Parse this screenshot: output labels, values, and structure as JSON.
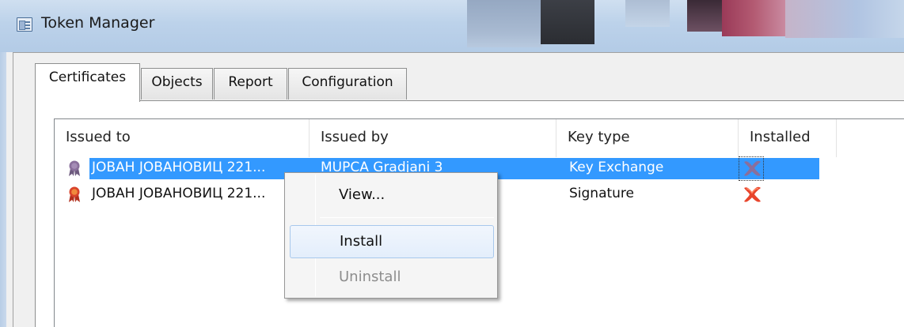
{
  "window": {
    "title": "Token Manager"
  },
  "tabs": [
    {
      "label": "Certificates",
      "active": true
    },
    {
      "label": "Objects",
      "active": false
    },
    {
      "label": "Report",
      "active": false
    },
    {
      "label": "Configuration",
      "active": false
    }
  ],
  "table": {
    "columns": [
      "Issued to",
      "Issued by",
      "Key type",
      "Installed"
    ],
    "rows": [
      {
        "issued_to": "ЈОВАН ЈОВАНОВИЦ 221...",
        "issued_by": "MUPCA Gradjani 3",
        "key_type": "Key Exchange",
        "installed": "no",
        "selected": true,
        "icon": "certificate-ribbon-icon"
      },
      {
        "issued_to": "ЈОВАН ЈОВАНОВИЦ 221...",
        "issued_by": "",
        "key_type": "Signature",
        "installed": "no",
        "selected": false,
        "icon": "certificate-ribbon-icon"
      }
    ]
  },
  "context_menu": {
    "items": [
      {
        "label": "View...",
        "enabled": true
      },
      {
        "label": "Install",
        "enabled": true,
        "hovered": true
      },
      {
        "label": "Uninstall",
        "enabled": false
      }
    ]
  },
  "colors": {
    "selection": "#3399ff",
    "not_installed_icon": "#e8452c",
    "cert_icon_selected": "#8a6f9c",
    "cert_icon": "#d9432b"
  }
}
